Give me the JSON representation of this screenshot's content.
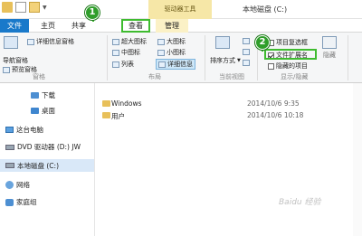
{
  "titlebar": {
    "title": "本地磁盘 (C:)",
    "context_tab_group": "驱动器工具"
  },
  "tabs": [
    {
      "label": "文件"
    },
    {
      "label": "主页"
    },
    {
      "label": "共享"
    },
    {
      "label": "查看"
    },
    {
      "label": "管理"
    }
  ],
  "ribbon": {
    "pane": {
      "nav_pane": "导航窗格",
      "preview_pane": "预览窗格",
      "details_pane": "详细信息窗格",
      "group": "窗格"
    },
    "layout": {
      "xlarge_icons": "超大图标",
      "large_icons": "大图标",
      "medium_icons": "中图标",
      "small_icons": "小图标",
      "list": "列表",
      "details": "详细信息",
      "group": "布局"
    },
    "current_view": {
      "sort_by": "排序方式",
      "group": "当前视图"
    },
    "show_hide": {
      "item_checkboxes": "项目复选框",
      "file_extensions": "文件扩展名",
      "hidden_items": "隐藏的项目",
      "hide_selected": "隐藏",
      "group": "显示/隐藏"
    }
  },
  "badges": {
    "one": "1",
    "two": "2"
  },
  "nav": {
    "items": [
      {
        "label": "下载"
      },
      {
        "label": "桌面"
      },
      {
        "label": "这台电脑"
      },
      {
        "label": "DVD 驱动器 (D:) JW"
      },
      {
        "label": "本地磁盘 (C:)"
      },
      {
        "label": "网络"
      },
      {
        "label": "家庭组"
      }
    ]
  },
  "files": [
    {
      "name": "Windows",
      "date": "2014/10/6 9:35"
    },
    {
      "name": "用户",
      "date": "2014/10/6 10:18"
    }
  ],
  "watermark": "Baidu 经验"
}
